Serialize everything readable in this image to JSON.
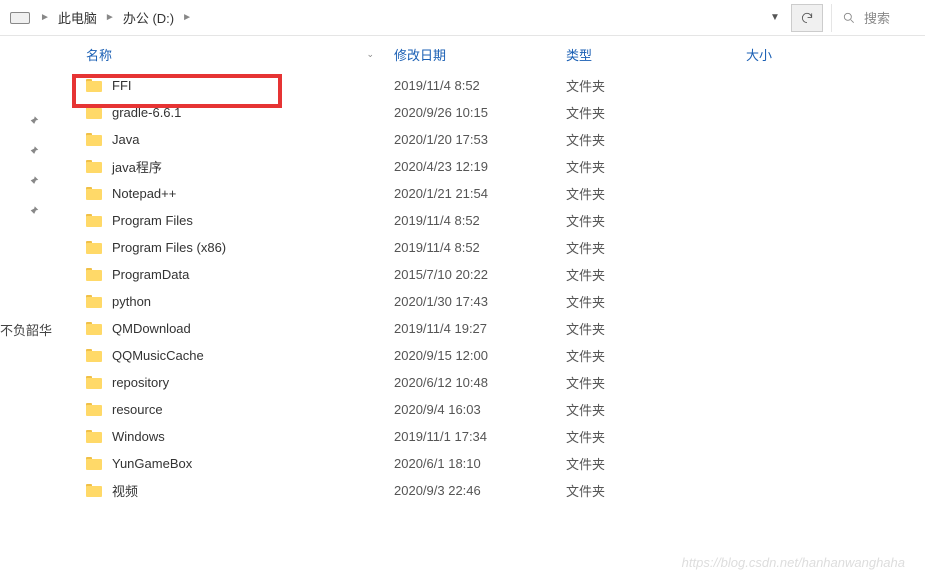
{
  "breadcrumb": {
    "items": [
      "此电脑",
      "办公 (D:)"
    ]
  },
  "search": {
    "placeholder": "搜索"
  },
  "columns": {
    "name": "名称",
    "date": "修改日期",
    "type": "类型",
    "size": "大小"
  },
  "files": [
    {
      "name": "FFI",
      "date": "2019/11/4 8:52",
      "type": "文件夹"
    },
    {
      "name": "gradle-6.6.1",
      "date": "2020/9/26 10:15",
      "type": "文件夹"
    },
    {
      "name": "Java",
      "date": "2020/1/20 17:53",
      "type": "文件夹"
    },
    {
      "name": "java程序",
      "date": "2020/4/23 12:19",
      "type": "文件夹"
    },
    {
      "name": "Notepad++",
      "date": "2020/1/21 21:54",
      "type": "文件夹"
    },
    {
      "name": "Program Files",
      "date": "2019/11/4 8:52",
      "type": "文件夹"
    },
    {
      "name": "Program Files (x86)",
      "date": "2019/11/4 8:52",
      "type": "文件夹"
    },
    {
      "name": "ProgramData",
      "date": "2015/7/10 20:22",
      "type": "文件夹"
    },
    {
      "name": "python",
      "date": "2020/1/30 17:43",
      "type": "文件夹"
    },
    {
      "name": "QMDownload",
      "date": "2019/11/4 19:27",
      "type": "文件夹"
    },
    {
      "name": "QQMusicCache",
      "date": "2020/9/15 12:00",
      "type": "文件夹"
    },
    {
      "name": "repository",
      "date": "2020/6/12 10:48",
      "type": "文件夹"
    },
    {
      "name": "resource",
      "date": "2020/9/4 16:03",
      "type": "文件夹"
    },
    {
      "name": "Windows",
      "date": "2019/11/1 17:34",
      "type": "文件夹"
    },
    {
      "name": "YunGameBox",
      "date": "2020/6/1 18:10",
      "type": "文件夹"
    },
    {
      "name": "视频",
      "date": "2020/9/3 22:46",
      "type": "文件夹"
    }
  ],
  "sidebar_text": "不负韶华",
  "watermark": "https://blog.csdn.net/hanhanwanghaha"
}
